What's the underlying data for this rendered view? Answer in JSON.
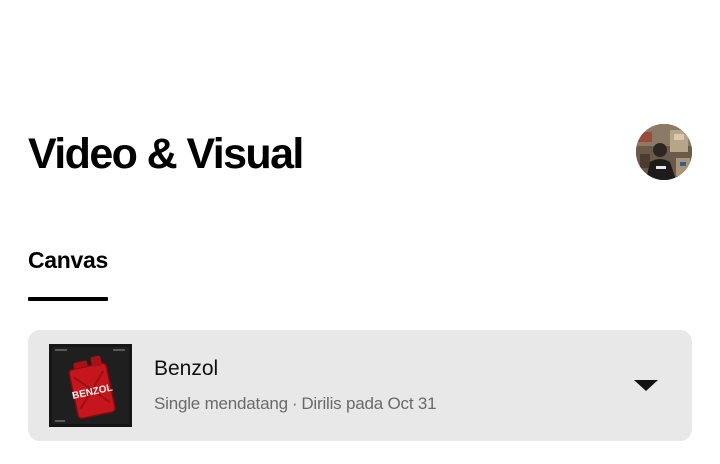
{
  "page": {
    "title": "Video & Visual"
  },
  "profile": {
    "icon": "user-avatar"
  },
  "tabs": [
    {
      "label": "Canvas",
      "active": true
    }
  ],
  "release": {
    "title": "Benzol",
    "status": "Single mendatang",
    "separator": "·",
    "release_info": "Dirilis pada Oct 31",
    "cover_text": "BENZOL",
    "expand_icon": "caret-down-icon"
  },
  "colors": {
    "card_background": "#e8e8e8",
    "meta_text": "#6a6a6a",
    "cover_red": "#c4161c"
  }
}
